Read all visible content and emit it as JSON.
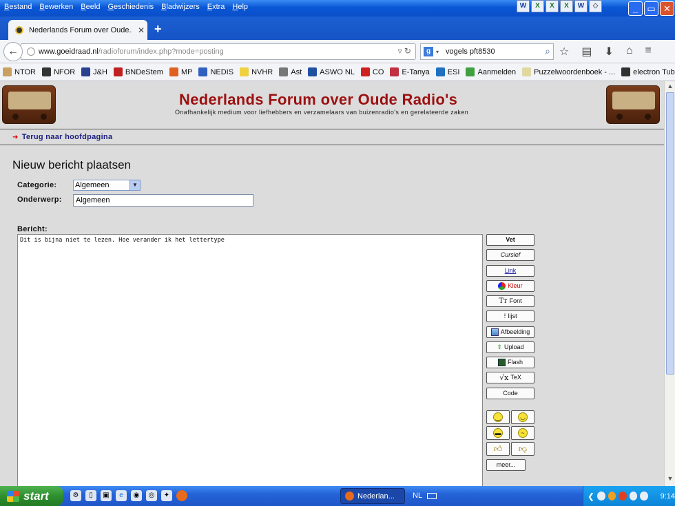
{
  "menu": [
    "Bestand",
    "Bewerken",
    "Beeld",
    "Geschiedenis",
    "Bladwijzers",
    "Extra",
    "Help"
  ],
  "office_icons": [
    "W",
    "X",
    "X",
    "X",
    "W"
  ],
  "tab": {
    "title": "Nederlands Forum over Oude..."
  },
  "address": {
    "host": "www.goeidraad.nl",
    "path": "/radioforum/index.php?mode=posting"
  },
  "search": {
    "engine_icon": "google-icon",
    "query": "vogels pft8530"
  },
  "bookmarks": [
    {
      "label": "NTOR",
      "color": "#c8a060"
    },
    {
      "label": "NFOR",
      "color": "#333333"
    },
    {
      "label": "J&H",
      "color": "#2a3f8f"
    },
    {
      "label": "BNDeStem",
      "color": "#c02020"
    },
    {
      "label": "MP",
      "color": "#e06020"
    },
    {
      "label": "NEDIS",
      "color": "#3060c0"
    },
    {
      "label": "NVHR",
      "color": "#f0d040"
    },
    {
      "label": "Ast",
      "color": "#777777"
    },
    {
      "label": "ASWO NL",
      "color": "#2050a0"
    },
    {
      "label": "CO",
      "color": "#d02020"
    },
    {
      "label": "E-Tanya",
      "color": "#c03040"
    },
    {
      "label": "ESI",
      "color": "#2070c0"
    },
    {
      "label": "Aanmelden",
      "color": "#40a040"
    },
    {
      "label": "Puzzelwoordenboek - ...",
      "color": "#e0d8a0"
    },
    {
      "label": "electron Tube Data sh...",
      "color": "#303030"
    }
  ],
  "site": {
    "title": "Nederlands Forum over Oude Radio's",
    "subtitle": "Onafhankelijk medium voor liefhebbers en verzamelaars van buizenradio's en gerelateerde zaken",
    "title_color": "#9c1010"
  },
  "back_link": "Terug naar hoofdpagina",
  "page_heading": "Nieuw bericht plaatsen",
  "form": {
    "category_label": "Categorie:",
    "category_value": "Algemeen",
    "subject_label": "Onderwerp:",
    "subject_value": "Algemeen",
    "message_label": "Bericht:",
    "message_text": "Dit is bijna niet te lezen. Hoe verander ik het lettertype"
  },
  "format_buttons": [
    {
      "label": "Vet",
      "icon": ""
    },
    {
      "label": "Cursief",
      "icon": ""
    },
    {
      "label": "Link",
      "icon": ""
    },
    {
      "label": "Kleur",
      "icon": "color-wheel-icon"
    },
    {
      "label": "Font",
      "icon": "font-icon"
    },
    {
      "label": "lijst",
      "icon": "list-icon"
    },
    {
      "label": "Afbeelding",
      "icon": "image-icon"
    },
    {
      "label": "Upload",
      "icon": "upload-arrow-icon"
    },
    {
      "label": "Flash",
      "icon": "film-icon"
    },
    {
      "label": "TeX",
      "icon": "sqrt-icon"
    },
    {
      "label": "Code",
      "icon": ""
    }
  ],
  "smileys": [
    "smile-icon",
    "happy-icon",
    "grin-icon",
    "worried-icon",
    "thumbs-up-icon",
    "thumbs-down-icon"
  ],
  "more_button": "meer...",
  "taskbar": {
    "start": "start",
    "task_title": "Nederlan...",
    "language": "NL",
    "clock": "9:14"
  }
}
